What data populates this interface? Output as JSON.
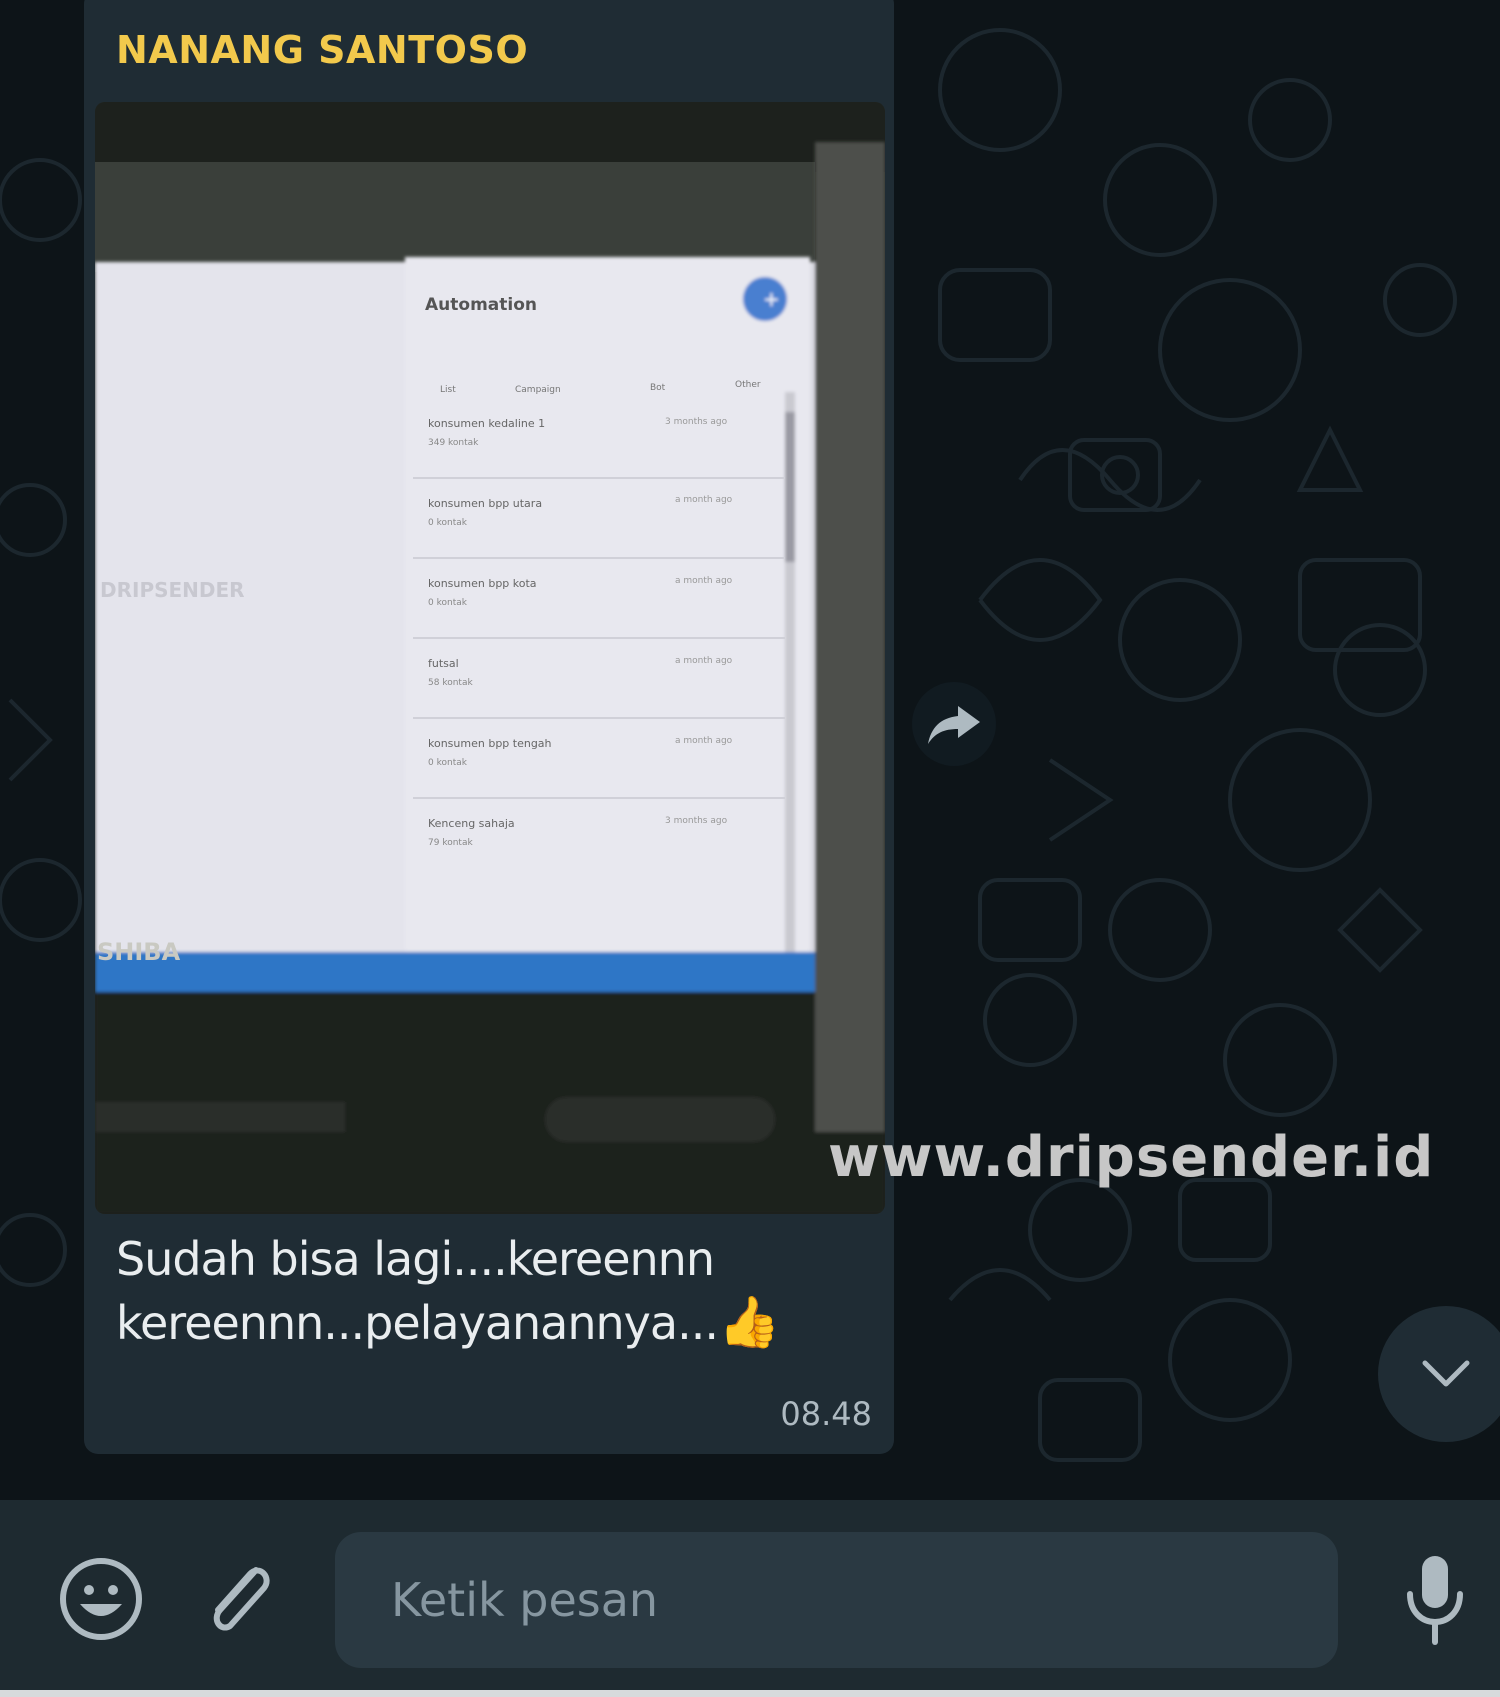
{
  "message": {
    "sender_name": "NANANG SANTOSO",
    "caption_line1": "Sudah bisa lagi....kereennn",
    "caption_line2": "kereennn...pelayanannya...",
    "emoji": "👍",
    "time": "08.48"
  },
  "photo": {
    "panel_title": "Automation",
    "tabs": [
      "List",
      "Campaign",
      "Bot",
      "Other"
    ],
    "list_items": [
      {
        "name": "konsumen kedaline 1",
        "count": "349 kontak",
        "when": "3 months ago"
      },
      {
        "name": "konsumen bpp utara",
        "count": "0 kontak",
        "when": "a month ago"
      },
      {
        "name": "konsumen bpp kota",
        "count": "0 kontak",
        "when": "a month ago"
      },
      {
        "name": "futsal",
        "count": "58 kontak",
        "when": "a month ago"
      },
      {
        "name": "konsumen bpp tengah",
        "count": "0 kontak",
        "when": "a month ago"
      },
      {
        "name": "Kenceng sahaja",
        "count": "79 kontak",
        "when": "3 months ago"
      }
    ],
    "brand_watermark": "DRIPSENDER",
    "laptop_brand": "SHIBA"
  },
  "overlay": {
    "watermark": "www.dripsender.id"
  },
  "composer": {
    "placeholder": "Ketik pesan"
  },
  "icons": {
    "emoji": "smiley-icon",
    "attach": "paperclip-icon",
    "mic": "microphone-icon",
    "forward": "forward-arrow-icon",
    "scroll": "chevron-down-icon"
  },
  "colors": {
    "background": "#0d1418",
    "bubble": "#1f2c34",
    "sender": "#f2c94c",
    "text": "#e9edef",
    "muted": "#8696a0"
  }
}
